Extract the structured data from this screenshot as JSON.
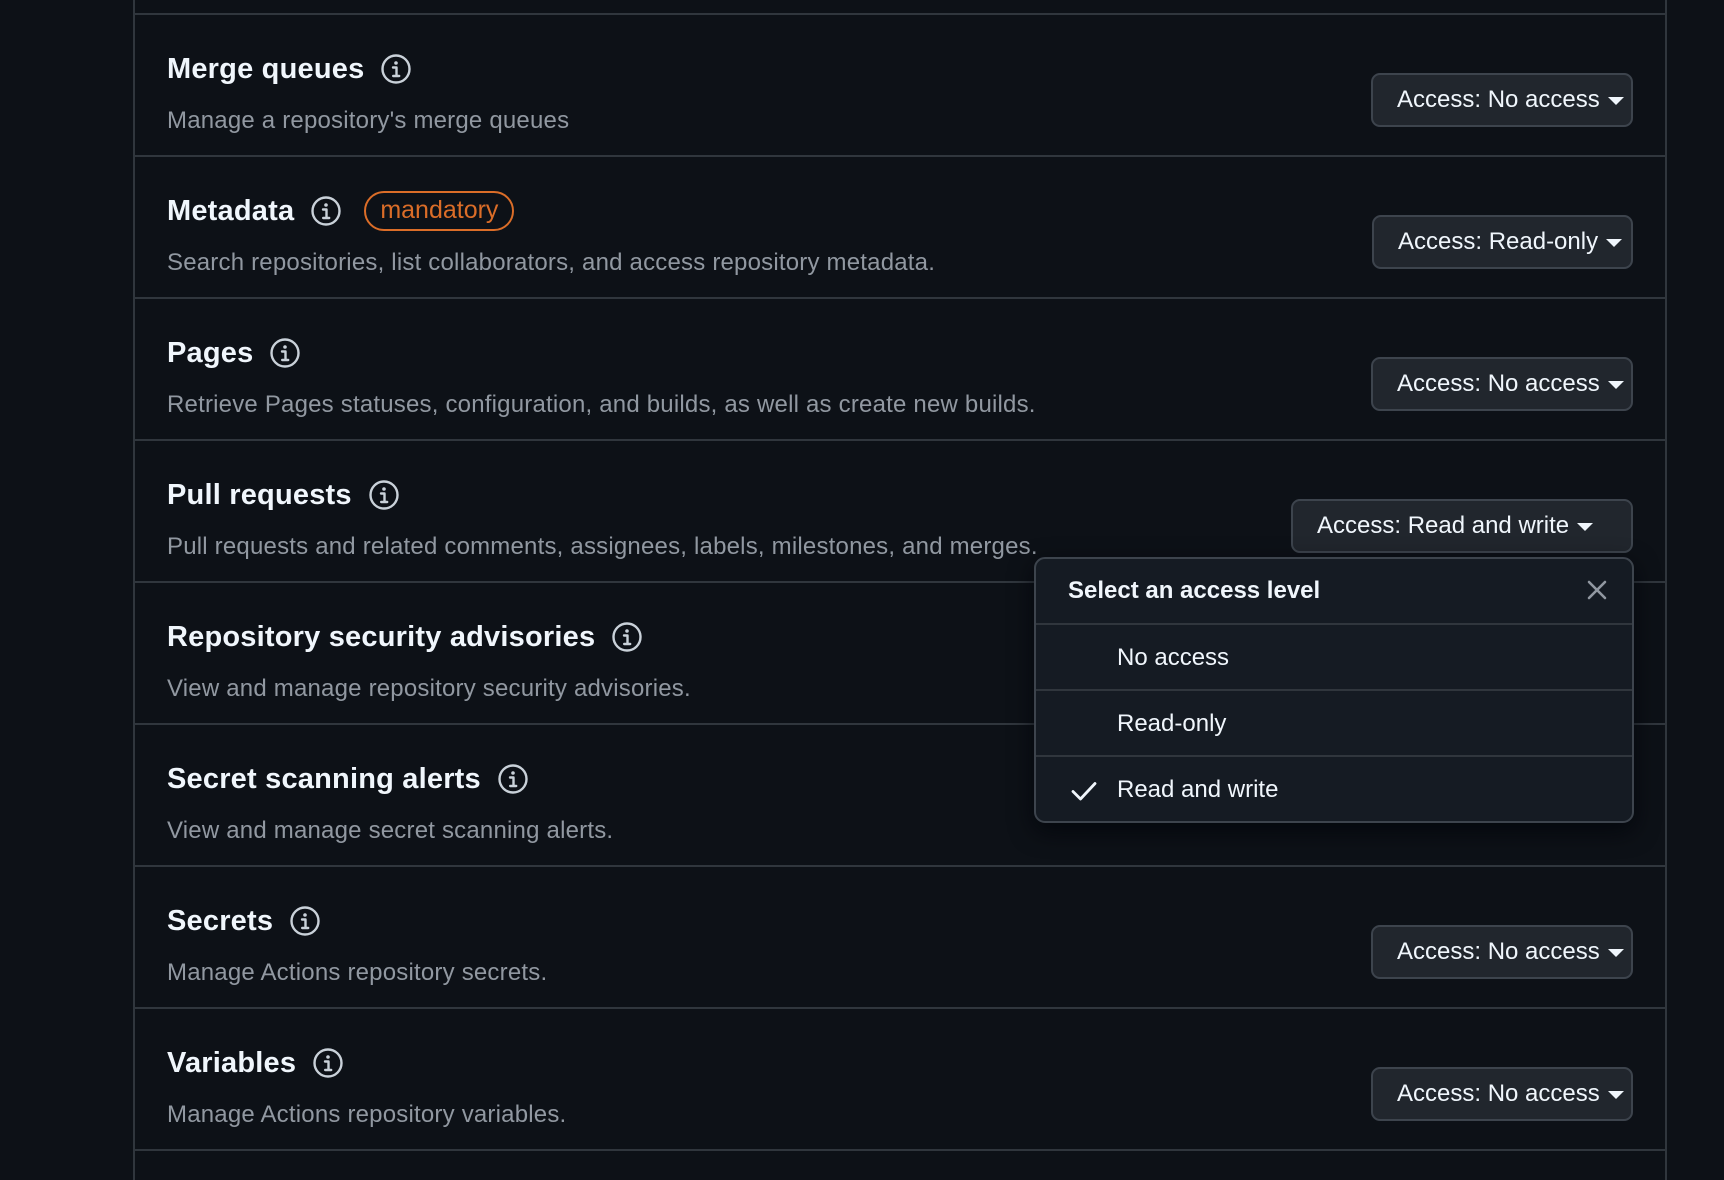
{
  "rows": [
    {
      "title": "Merge queues",
      "desc": "Manage a repository's merge queues",
      "access": "Access: No access"
    },
    {
      "title": "Metadata",
      "badge": "mandatory",
      "desc": "Search repositories, list collaborators, and access repository metadata.",
      "access": "Access: Read-only"
    },
    {
      "title": "Pages",
      "desc": "Retrieve Pages statuses, configuration, and builds, as well as create new builds.",
      "access": "Access: No access"
    },
    {
      "title": "Pull requests",
      "desc": "Pull requests and related comments, assignees, labels, milestones, and merges.",
      "access": "Access: Read and write"
    },
    {
      "title": "Repository security advisories",
      "desc": "View and manage repository security advisories."
    },
    {
      "title": "Secret scanning alerts",
      "desc": "View and manage secret scanning alerts."
    },
    {
      "title": "Secrets",
      "desc": "Manage Actions repository secrets.",
      "access": "Access: No access"
    },
    {
      "title": "Variables",
      "desc": "Manage Actions repository variables.",
      "access": "Access: No access"
    }
  ],
  "menu": {
    "title": "Select an access level",
    "options": [
      {
        "label": "No access",
        "selected": false
      },
      {
        "label": "Read-only",
        "selected": false
      },
      {
        "label": "Read and write",
        "selected": true
      }
    ]
  },
  "colors": {
    "background": "#0d1117",
    "border": "#30363d",
    "badge": "#db6d28",
    "muted_text": "#9198a1"
  },
  "icons": [
    "info-icon",
    "close-icon",
    "check-icon",
    "caret-down-icon"
  ]
}
